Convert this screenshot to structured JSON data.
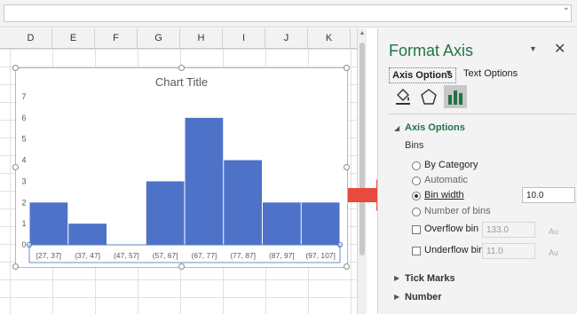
{
  "columns": [
    "D",
    "E",
    "F",
    "G",
    "H",
    "I",
    "J",
    "K"
  ],
  "chart": {
    "title": "Chart Title",
    "accent": "#4f72c9"
  },
  "chart_data": {
    "type": "bar",
    "categories": [
      "[27, 37]",
      "(37, 47]",
      "(47, 57]",
      "(57, 67]",
      "(67, 77]",
      "(77, 87]",
      "(87, 97]",
      "(97, 107]"
    ],
    "values": [
      2,
      1,
      0,
      3,
      6,
      4,
      2,
      2
    ],
    "title": "Chart Title",
    "xlabel": "",
    "ylabel": "",
    "ylim": [
      0,
      7
    ],
    "yticks": [
      "0",
      "1",
      "2",
      "3",
      "4",
      "5",
      "6",
      "7"
    ],
    "grid": false
  },
  "pane": {
    "title": "Format Axis",
    "tab_axis_options": "Axis Options",
    "tab_text_options": "Text Options",
    "section_axis_options": "Axis Options",
    "bins_label": "Bins",
    "options": {
      "by_category": "By Category",
      "automatic": "Automatic",
      "bin_width": "Bin width",
      "number_of_bins": "Number of bins",
      "overflow_bin": "Overflow bin",
      "underflow_bin": "Underflow bin"
    },
    "bin_width_value": "10.0",
    "overflow_value": "133.0",
    "underflow_value": "11.0",
    "auto_label": "Au",
    "tick_marks": "Tick Marks",
    "number": "Number",
    "icons": [
      "fill-line-icon",
      "effects-pentagon-icon",
      "bar-chart-icon"
    ]
  },
  "colors": {
    "brand_green": "#217346",
    "highlight_red": "#e03c31"
  }
}
